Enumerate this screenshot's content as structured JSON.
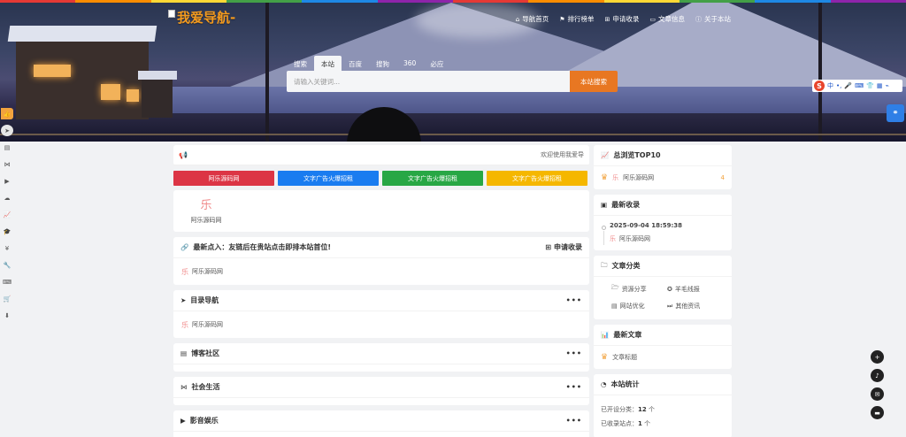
{
  "colors": {
    "strip": [
      "#e53935",
      "#fb8c00",
      "#fdd835",
      "#43a047",
      "#1e88e5",
      "#8e24aa",
      "#e53935",
      "#fb8c00",
      "#fdd835",
      "#43a047",
      "#1e88e5",
      "#8e24aa"
    ],
    "ad1": "#dc3545",
    "ad2": "#1a7cf0",
    "ad3": "#28a745",
    "ad4": "#f5b700",
    "accent": "#e87722"
  },
  "logo": {
    "text": "我爱导航-"
  },
  "topnav": [
    {
      "icon": "home-icon",
      "glyph": "⌂",
      "label": "导航首页"
    },
    {
      "icon": "flag-icon",
      "glyph": "⚑",
      "label": "排行榜单"
    },
    {
      "icon": "plus-square-icon",
      "glyph": "⊞",
      "label": "申请收录"
    },
    {
      "icon": "folder-icon",
      "glyph": "▭",
      "label": "文章信息"
    },
    {
      "icon": "info-icon",
      "glyph": "ⓘ",
      "label": "关于本站"
    }
  ],
  "search": {
    "tabs": [
      "搜索",
      "本站",
      "百度",
      "搜狗",
      "360",
      "必应"
    ],
    "active_tab": "本站",
    "placeholder": "请输入关键词...",
    "button": "本站搜索"
  },
  "ime": {
    "brand": "S",
    "items": [
      "中",
      "•,",
      "🎤",
      "⌨",
      "👕",
      "▦",
      "⌁"
    ]
  },
  "notice": {
    "text": "欢迎使用我爱导"
  },
  "ads": [
    "阿乐源码网",
    "文字广告火爆招租",
    "文字广告火爆招租",
    "文字广告火爆招租"
  ],
  "featured_site": {
    "name": "阿乐源码网"
  },
  "recent_click": {
    "title": "最新点入：友链后在贵站点击即排本站首位!",
    "right": "申请收录",
    "item": "阿乐源码网"
  },
  "sections": [
    {
      "icon": "send-icon",
      "glyph": "➤",
      "title": "目录导航",
      "item": "阿乐源码网"
    },
    {
      "icon": "file-icon",
      "glyph": "▤",
      "title": "博客社区",
      "item": ""
    },
    {
      "icon": "share-icon",
      "glyph": "⋈",
      "title": "社会生活",
      "item": ""
    },
    {
      "icon": "video-icon",
      "glyph": "▶",
      "title": "影音娱乐",
      "item": ""
    }
  ],
  "side": {
    "top10": {
      "title": "总浏览TOP10",
      "item": "阿乐源码网",
      "count": "4"
    },
    "latest": {
      "title": "最新收录",
      "date": "2025-09-04 18:59:38",
      "item": "阿乐源码网"
    },
    "categories": {
      "title": "文章分类",
      "items": [
        "资源分享",
        "羊毛线报",
        "网站优化",
        "其他资讯"
      ]
    },
    "articles": {
      "title": "最新文章",
      "item": "文章标题"
    },
    "stats": {
      "title": "本站统计",
      "line1_label": "已开设分类：",
      "line1_value": "12",
      "line1_unit": "个",
      "line2_label": "已收录站点：",
      "line2_value": "1",
      "line2_unit": "个"
    }
  },
  "sidebar_left": [
    "thumbs-up-icon",
    "send-icon",
    "file-icon",
    "share-icon",
    "video-icon",
    "cloud-icon",
    "chart-icon",
    "graduation-icon",
    "yen-icon",
    "wrench-icon",
    "keyboard-icon",
    "cart-icon",
    "download-icon"
  ],
  "right_float": [
    "plus-icon",
    "bell-icon",
    "wechat-icon",
    "mail-icon"
  ]
}
